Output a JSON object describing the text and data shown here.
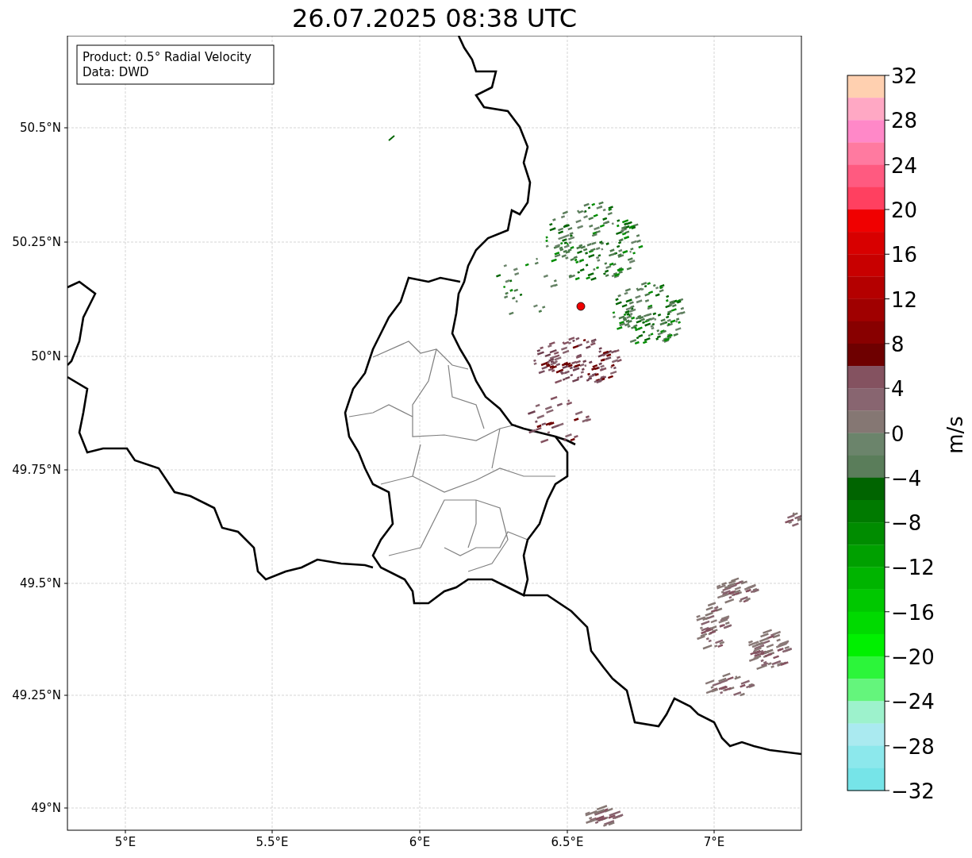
{
  "title": "26.07.2025 08:38 UTC",
  "info_box": [
    "Product: 0.5° Radial Velocity",
    "Data: DWD"
  ],
  "x_ticks": [
    "5°E",
    "5.5°E",
    "6°E",
    "6.5°E",
    "7°E"
  ],
  "y_ticks": [
    "50.5°N",
    "50.25°N",
    "50°N",
    "49.75°N",
    "49.5°N",
    "49.25°N",
    "49°N"
  ],
  "colorbar": {
    "label": "m/s",
    "ticks": [
      "32",
      "28",
      "24",
      "20",
      "16",
      "12",
      "8",
      "4",
      "0",
      "−4",
      "−8",
      "−12",
      "−16",
      "−20",
      "−24",
      "−28",
      "−32"
    ],
    "segments": [
      {
        "color": "#ffd0b0"
      },
      {
        "color": "#ffa8c4"
      },
      {
        "color": "#ff88c8"
      },
      {
        "color": "#ff7aa0"
      },
      {
        "color": "#ff5a80"
      },
      {
        "color": "#ff4060"
      },
      {
        "color": "#f00000"
      },
      {
        "color": "#d80000"
      },
      {
        "color": "#c80000"
      },
      {
        "color": "#b40000"
      },
      {
        "color": "#a00000"
      },
      {
        "color": "#880000"
      },
      {
        "color": "#6e0000"
      },
      {
        "color": "#845260"
      },
      {
        "color": "#886570"
      },
      {
        "color": "#857773"
      },
      {
        "color": "#6b846b"
      },
      {
        "color": "#5a7d5a"
      },
      {
        "color": "#006400"
      },
      {
        "color": "#007a00"
      },
      {
        "color": "#008c00"
      },
      {
        "color": "#00a000"
      },
      {
        "color": "#00b400"
      },
      {
        "color": "#00c800"
      },
      {
        "color": "#00da00"
      },
      {
        "color": "#00f000"
      },
      {
        "color": "#2cf53a"
      },
      {
        "color": "#64f57c"
      },
      {
        "color": "#9df2cc"
      },
      {
        "color": "#aaeaf0"
      },
      {
        "color": "#8ce8ec"
      },
      {
        "color": "#76e4e8"
      }
    ]
  }
}
